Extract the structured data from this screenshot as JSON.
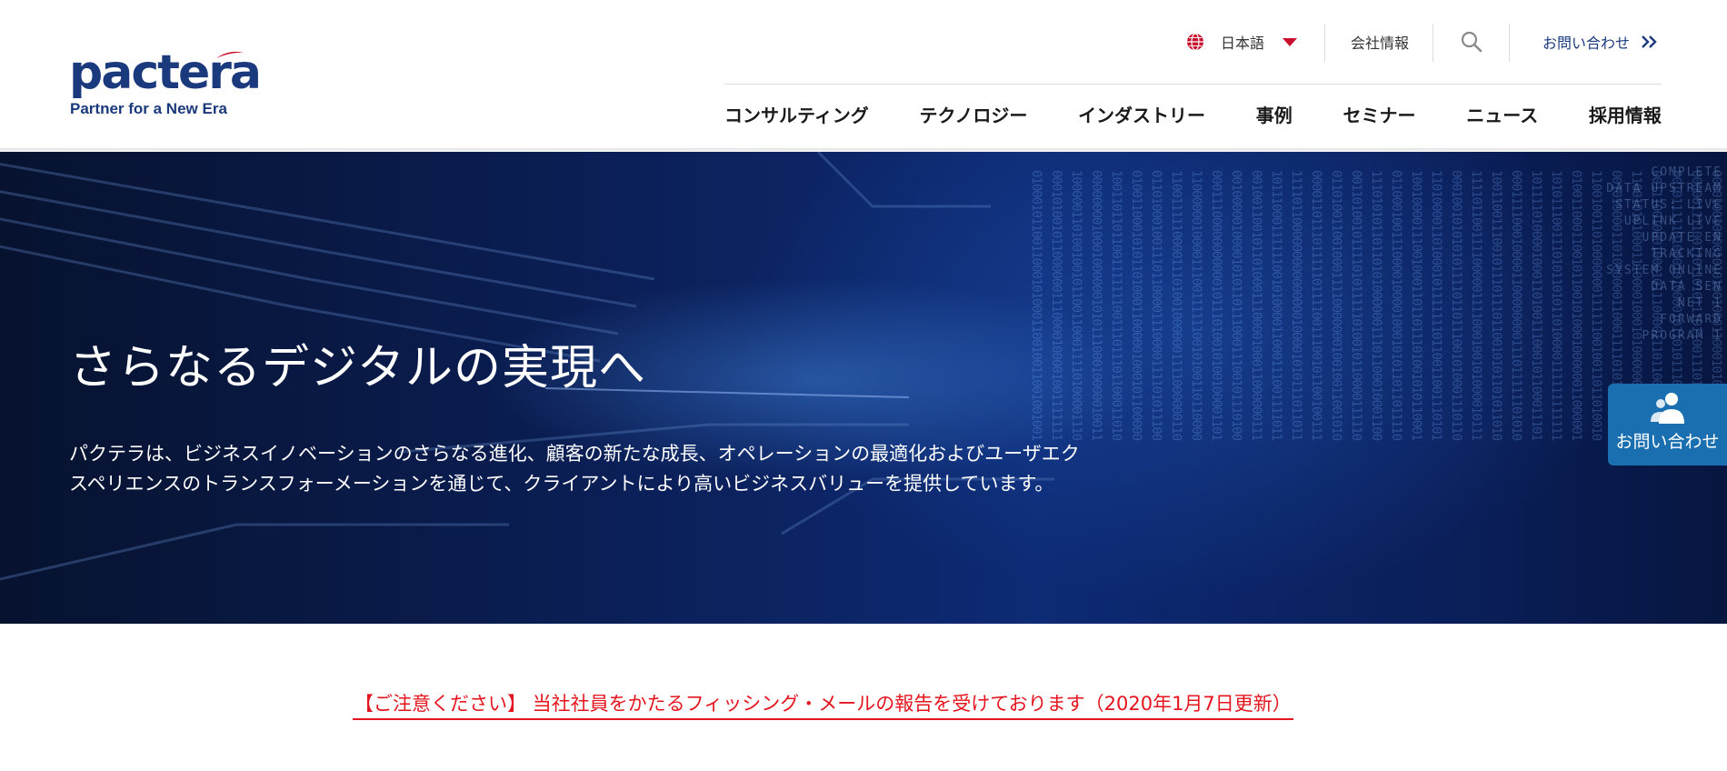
{
  "brand": {
    "logo_text": "pactera",
    "tagline": "Partner for a New Era",
    "color": "#1b3a7d",
    "accent": "#c8102e"
  },
  "utility": {
    "language_label": "日本語",
    "company_label": "会社情報",
    "contact_label": "お問い合わせ",
    "icons": [
      "globe-icon",
      "caret-down-icon",
      "search-icon",
      "double-chevron-right-icon"
    ]
  },
  "nav": {
    "items": [
      "コンサルティング",
      "テクノロジー",
      "インダストリー",
      "事例",
      "セミナー",
      "ニュース",
      "採用情報"
    ]
  },
  "hero": {
    "title": "さらなるデジタルの実現へ",
    "body": "パクテラは、ビジネスイノベーションのさらなる進化、顧客の新たな成長、オペレーションの最適化およびユーザエクスペリエンスのトランスフォーメーションを通じて、クライアントにより高いビジネスバリューを提供しています。",
    "background_texts": [
      "COMPLETE",
      "DATA UPSTREAM",
      "STATUS: LIVE",
      "UPLINK LIVE",
      "UPDATE EN",
      "TRACKING",
      "SYSTEM ONLINE",
      "DATA SEN",
      "NET 1",
      "FORWARD",
      "PROGRAM 1"
    ]
  },
  "floating_contact": {
    "label": "お問い合わせ",
    "icon": "person-icon",
    "color": "#1a6fb0"
  },
  "notice": {
    "text": "【ご注意ください】 当社社員をかたるフィッシング・メールの報告を受けております（2020年1月7日更新）",
    "color": "#e4151e"
  }
}
